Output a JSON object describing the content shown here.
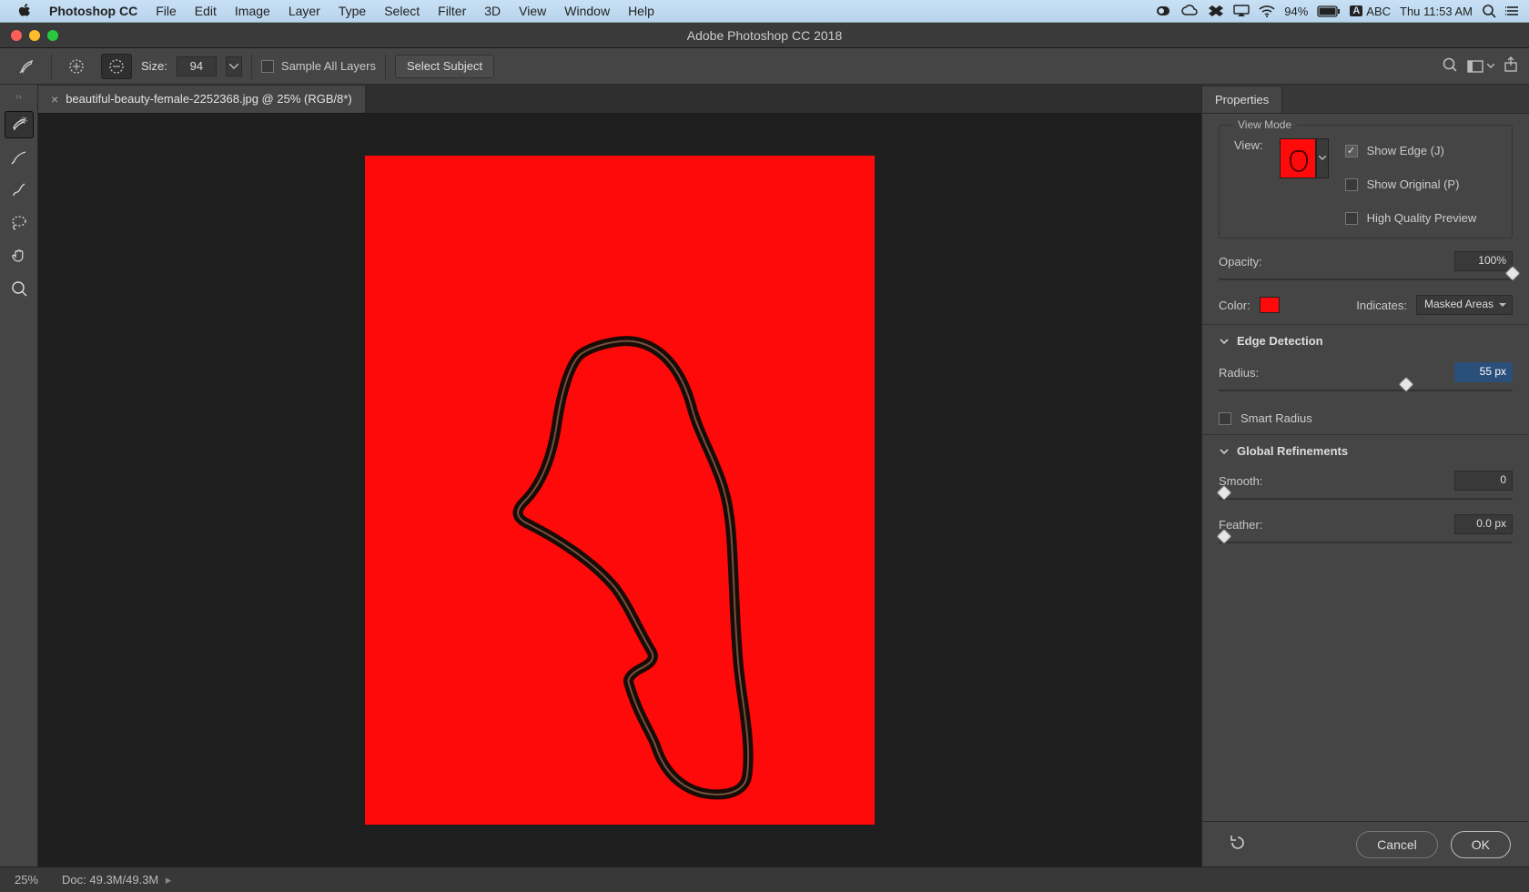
{
  "menubar": {
    "apple_icon": "apple-logo",
    "app_name": "Photoshop CC",
    "items": [
      "File",
      "Edit",
      "Image",
      "Layer",
      "Type",
      "Select",
      "Filter",
      "3D",
      "View",
      "Window",
      "Help"
    ],
    "right_battery_pct": "94%",
    "right_input": "ABC",
    "right_time": "Thu 11:53 AM"
  },
  "window": {
    "title": "Adobe Photoshop CC 2018"
  },
  "options_bar": {
    "size_label": "Size:",
    "size_value": "94",
    "sample_all_layers_label": "Sample All Layers",
    "sample_all_layers_checked": false,
    "select_subject_label": "Select Subject"
  },
  "document": {
    "tab_label": "beautiful-beauty-female-2252368.jpg @ 25% (RGB/8*)"
  },
  "status_bar": {
    "zoom": "25%",
    "doc_info": "Doc: 49.3M/49.3M"
  },
  "properties": {
    "panel_title": "Properties",
    "view_mode": {
      "header": "View Mode",
      "view_label": "View:",
      "show_edge": {
        "label": "Show Edge (J)",
        "checked": true
      },
      "show_original": {
        "label": "Show Original (P)",
        "checked": false
      },
      "high_quality_preview": {
        "label": "High Quality Preview",
        "checked": false
      }
    },
    "opacity": {
      "label": "Opacity:",
      "value": "100%",
      "slider_pos_pct": 100
    },
    "color": {
      "label": "Color:",
      "hex": "#ff0a0a"
    },
    "indicates": {
      "label": "Indicates:",
      "value": "Masked Areas"
    },
    "edge_detection": {
      "header": "Edge Detection",
      "radius_label": "Radius:",
      "radius_value": "55 px",
      "radius_slider_pos_pct": 62,
      "smart_radius": {
        "label": "Smart Radius",
        "checked": false
      }
    },
    "global_refinements": {
      "header": "Global Refinements",
      "smooth_label": "Smooth:",
      "smooth_value": "0",
      "smooth_pos_pct": 0,
      "feather_label": "Feather:",
      "feather_value": "0.0 px",
      "feather_pos_pct": 0
    },
    "buttons": {
      "cancel": "Cancel",
      "ok": "OK"
    }
  }
}
